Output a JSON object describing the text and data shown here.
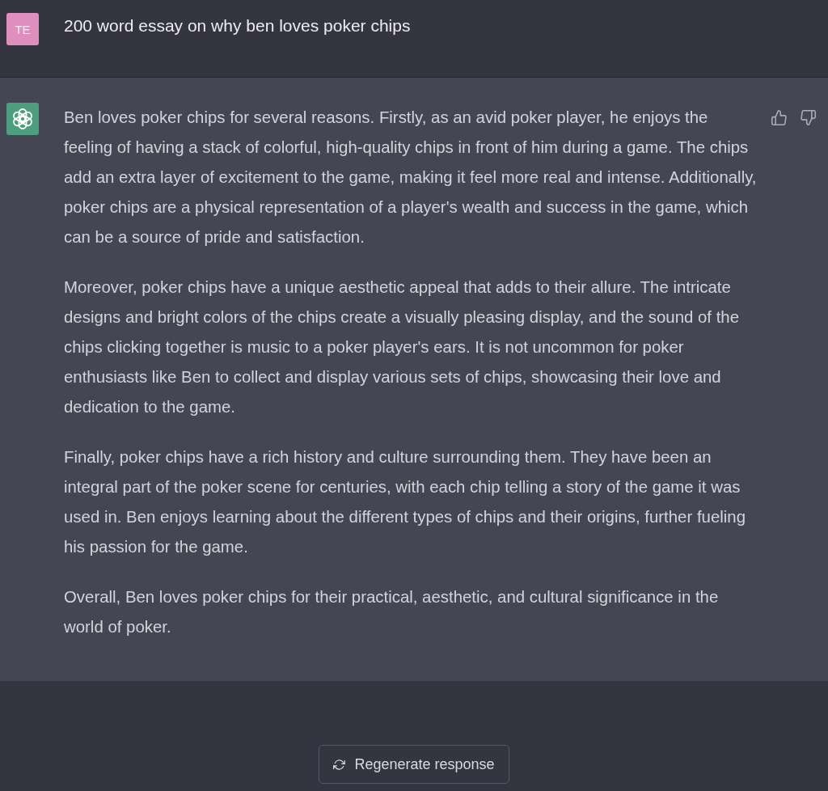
{
  "messages": [
    {
      "kind": "user",
      "avatar": "TE",
      "text": "200 word essay on why ben loves poker chips"
    },
    {
      "kind": "assistant",
      "paragraphs": [
        "Ben loves poker chips for several reasons. Firstly, as an avid poker player, he enjoys the feeling of having a stack of colorful, high-quality chips in front of him during a game. The chips add an extra layer of excitement to the game, making it feel more real and intense. Additionally, poker chips are a physical representation of a player's wealth and success in the game, which can be a source of pride and satisfaction.",
        "Moreover, poker chips have a unique aesthetic appeal that adds to their allure. The intricate designs and bright colors of the chips create a visually pleasing display, and the sound of the chips clicking together is music to a poker player's ears. It is not uncommon for poker enthusiasts like Ben to collect and display various sets of chips, showcasing their love and dedication to the game.",
        "Finally, poker chips have a rich history and culture surrounding them. They have been an integral part of the poker scene for centuries, with each chip telling a story of the game it was used in. Ben enjoys learning about the different types of chips and their origins, further fueling his passion for the game.",
        "Overall, Ben loves poker chips for their practical, aesthetic, and cultural significance in the world of poker."
      ]
    }
  ],
  "regenerate_button": {
    "label": "Regenerate response"
  }
}
